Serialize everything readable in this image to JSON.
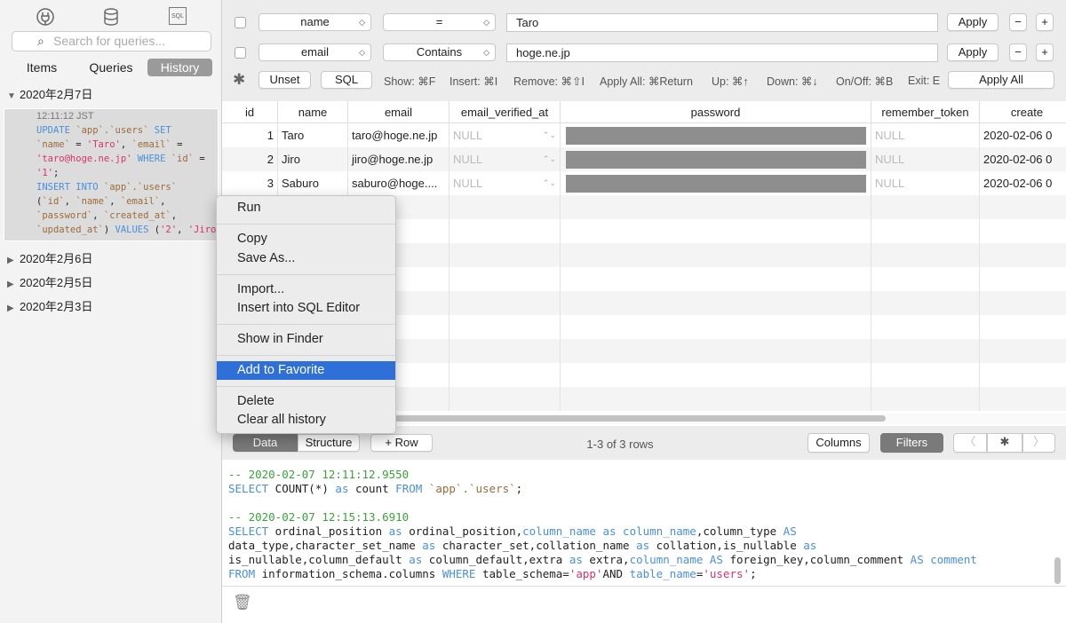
{
  "sidebar": {
    "icons": [
      "plug-icon",
      "database-icon",
      "sql-icon"
    ],
    "sql_icon_text": "SQL",
    "search_placeholder": "Search for queries...",
    "tabs": [
      "Items",
      "Queries",
      "History"
    ],
    "active_tab": "History",
    "groups": [
      {
        "label": "2020年2月7日",
        "expanded": true
      },
      {
        "label": "2020年2月6日",
        "expanded": false
      },
      {
        "label": "2020年2月5日",
        "expanded": false
      },
      {
        "label": "2020年2月3日",
        "expanded": false
      }
    ],
    "history_item": {
      "time": "12:11:12 JST",
      "sql": "UPDATE `app`.`users` SET `name` = 'Taro', `email` = 'taro@hoge.ne.jp' WHERE `id` = '1'; INSERT INTO `app`.`users` (`id`, `name`, `email`, `password`, `created_at`, `updated_at`) VALUES ('2', 'Jiro…"
    }
  },
  "filters": [
    {
      "column": "name",
      "operator": "=",
      "value": "Taro",
      "apply": "Apply"
    },
    {
      "column": "email",
      "operator": "Contains",
      "value": "hoge.ne.jp",
      "apply": "Apply"
    }
  ],
  "filter_toolbar": {
    "unset": "Unset",
    "sql": "SQL",
    "apply_all": "Apply All",
    "shortcuts": [
      "Show: ⌘F",
      "Insert: ⌘I",
      "Remove: ⌘⇧I",
      "Apply All: ⌘Return",
      "Up: ⌘↑",
      "Down: ⌘↓",
      "On/Off: ⌘B",
      "Exit: E"
    ]
  },
  "table": {
    "columns": [
      "id",
      "name",
      "email",
      "email_verified_at",
      "password",
      "remember_token",
      "create"
    ],
    "rows": [
      [
        "1",
        "Taro",
        "taro@hoge.ne.jp",
        "NULL",
        "",
        "NULL",
        "2020-02-06 0"
      ],
      [
        "2",
        "Jiro",
        "jiro@hoge.ne.jp",
        "NULL",
        "",
        "NULL",
        "2020-02-06 0"
      ],
      [
        "3",
        "Saburo",
        "saburo@hoge....",
        "NULL",
        "",
        "NULL",
        "2020-02-06 0"
      ]
    ]
  },
  "bottom_bar": {
    "data": "Data",
    "structure": "Structure",
    "add_row": "Row",
    "row_count": "1-3 of 3 rows",
    "columns": "Columns",
    "filters": "Filters"
  },
  "log": {
    "entries": [
      {
        "comment": "-- 2020-02-07 12:11:12.9550",
        "sql": "SELECT COUNT(*) as count FROM `app`.`users`;"
      },
      {
        "comment": "-- 2020-02-07 12:15:13.6910",
        "sql": "SELECT ordinal_position as ordinal_position,column_name as column_name,column_type AS data_type,character_set_name as character_set,collation_name as collation,is_nullable as is_nullable,column_default as column_default,extra as extra,column_name AS foreign_key,column_comment AS comment FROM information_schema.columns WHERE table_schema='app'AND table_name='users';"
      }
    ]
  },
  "context_menu": {
    "items": [
      "Run",
      "Copy",
      "Save As...",
      "Import...",
      "Insert into SQL Editor",
      "Show in Finder",
      "Add to Favorite",
      "Delete",
      "Clear all history"
    ],
    "highlighted": "Add to Favorite"
  },
  "colors": {
    "highlight": "#2e6fd8",
    "keyword": "#4a90d9",
    "string": "#d6336c",
    "comment": "#3aa33a"
  }
}
